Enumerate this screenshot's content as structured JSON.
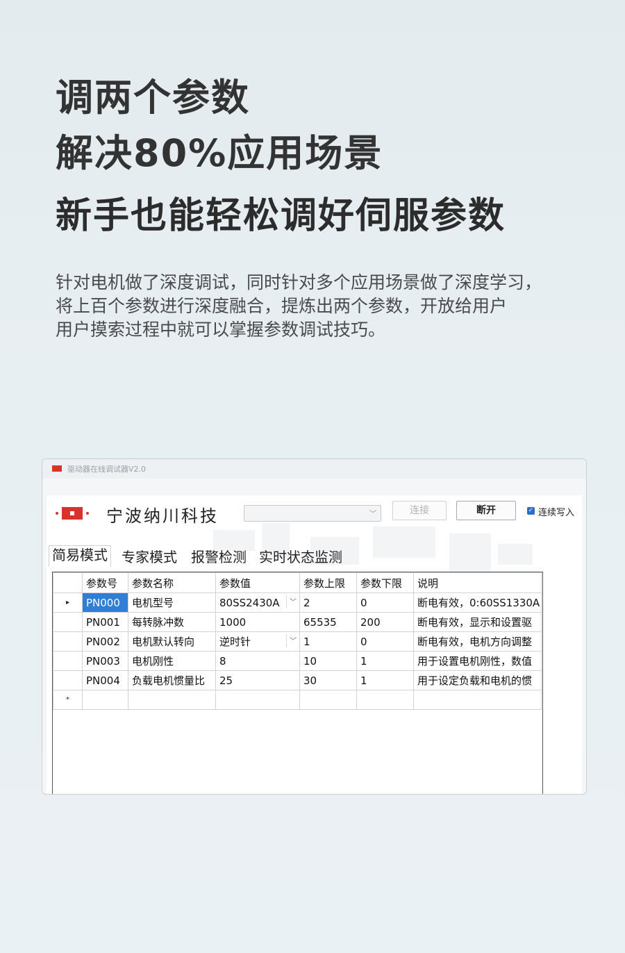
{
  "headline": {
    "line1": "调两个参数",
    "line2": "解决80%应用场景",
    "line3": "新手也能轻松调好伺服参数"
  },
  "paragraph": {
    "line1": "针对电机做了深度调试，同时针对多个应用场景做了深度学习，",
    "line2": "将上百个参数进行深度融合，提炼出两个参数，开放给用户",
    "line3": "用户摸索过程中就可以掌握参数调试技巧。"
  },
  "window": {
    "title": "驱动器在线调试器V2.0",
    "company": "宁波纳川科技",
    "connect_label": "连接",
    "disconnect_label": "断开",
    "continuous_write_label": "连续写入",
    "continuous_write_checked": true,
    "accent_color": "#2f7fd6",
    "logo_color": "#d9322b"
  },
  "tabs": [
    "简易模式",
    "专家模式",
    "报警检测",
    "实时状态监测"
  ],
  "grid": {
    "columns": [
      "参数号",
      "参数名称",
      "参数值",
      "参数上限",
      "参数下限",
      "说明"
    ],
    "rows": [
      {
        "marker": "▸",
        "id": "PN000",
        "name": "电机型号",
        "value": "80SS2430A",
        "upper": "2",
        "lower": "0",
        "desc": "断电有效，0:60SS1330A"
      },
      {
        "marker": "",
        "id": "PN001",
        "name": "每转脉冲数",
        "value": "1000",
        "upper": "65535",
        "lower": "200",
        "desc": "断电有效，显示和设置驱"
      },
      {
        "marker": "",
        "id": "PN002",
        "name": "电机默认转向",
        "value": "逆时针",
        "upper": "1",
        "lower": "0",
        "desc": "断电有效，电机方向调整"
      },
      {
        "marker": "",
        "id": "PN003",
        "name": "电机刚性",
        "value": "8",
        "upper": "10",
        "lower": "1",
        "desc": "用于设置电机刚性，数值"
      },
      {
        "marker": "",
        "id": "PN004",
        "name": "负载电机惯量比",
        "value": "25",
        "upper": "30",
        "lower": "1",
        "desc": "用于设定负载和电机的惯"
      }
    ],
    "new_row_marker": "*"
  }
}
